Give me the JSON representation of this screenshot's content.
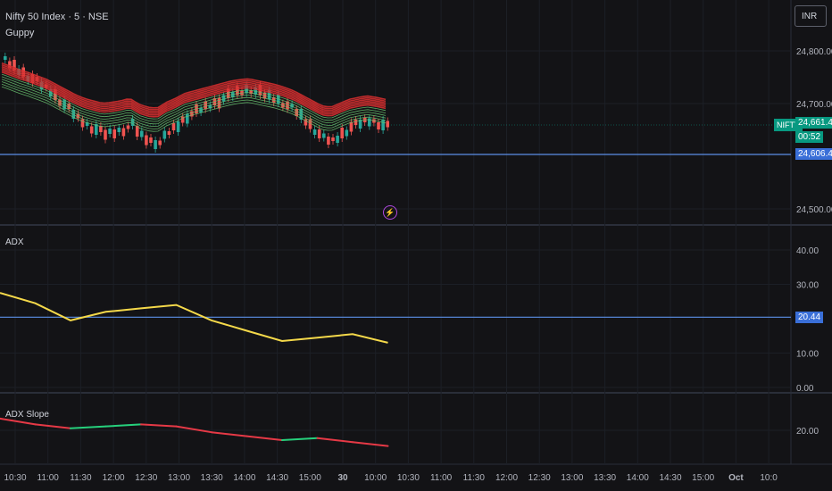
{
  "header": {
    "symbol_title": "Nifty 50 Index · 5 · NSE",
    "indicator": "Guppy",
    "currency": "INR"
  },
  "price_pane": {
    "y_ticks": [
      "24,800.00",
      "24,700.00",
      "24,500.00"
    ],
    "symbol_badge": "NIFTY",
    "last_price": "24,661.40",
    "countdown": "00:52",
    "hline_price": "24,606.45",
    "colors": {
      "up": "#26a69a",
      "down": "#ef5350",
      "long_ema": "#d32f2f",
      "short_ema": "#66bb6a",
      "hline": "#5b8fe6"
    }
  },
  "adx_pane": {
    "title": "ADX",
    "y_ticks": [
      "40.00",
      "30.00",
      "10.00",
      "0.00"
    ],
    "current_value": "20.44",
    "line_color": "#f5d94a"
  },
  "slope_pane": {
    "title": "ADX Slope",
    "y_ticks": [
      "20.00"
    ],
    "colors": {
      "rising": "#26d07c",
      "falling": "#e63946"
    }
  },
  "time_axis": {
    "labels": [
      "10:30",
      "11:00",
      "11:30",
      "12:00",
      "12:30",
      "13:00",
      "13:30",
      "14:00",
      "14:30",
      "15:00",
      "30",
      "10:00",
      "10:30",
      "11:00",
      "11:30",
      "12:00",
      "12:30",
      "13:00",
      "13:30",
      "14:00",
      "14:30",
      "15:00",
      "Oct",
      "10:0"
    ]
  },
  "chart_data": [
    {
      "type": "line",
      "title": "ADX",
      "x": [
        "10:30",
        "11:00",
        "11:30",
        "12:00",
        "12:30",
        "13:00",
        "13:30",
        "14:00",
        "14:30",
        "15:00",
        "30",
        "10:00"
      ],
      "series": [
        {
          "values": [
            27.5,
            24.5,
            19.5,
            22.0,
            23.0,
            24.0,
            19.5,
            16.5,
            13.5,
            14.5,
            15.5,
            13.0
          ]
        }
      ],
      "ylim": [
        0,
        45
      ]
    },
    {
      "type": "line",
      "title": "ADX Slope",
      "x": [
        "10:30",
        "11:00",
        "11:30",
        "12:00",
        "12:30",
        "13:00",
        "13:30",
        "14:00",
        "14:30",
        "15:00",
        "30",
        "10:00"
      ],
      "series": [
        {
          "values": [
            26,
            23,
            21,
            22,
            23,
            22,
            19,
            17,
            15,
            16,
            14,
            12
          ]
        }
      ]
    }
  ]
}
